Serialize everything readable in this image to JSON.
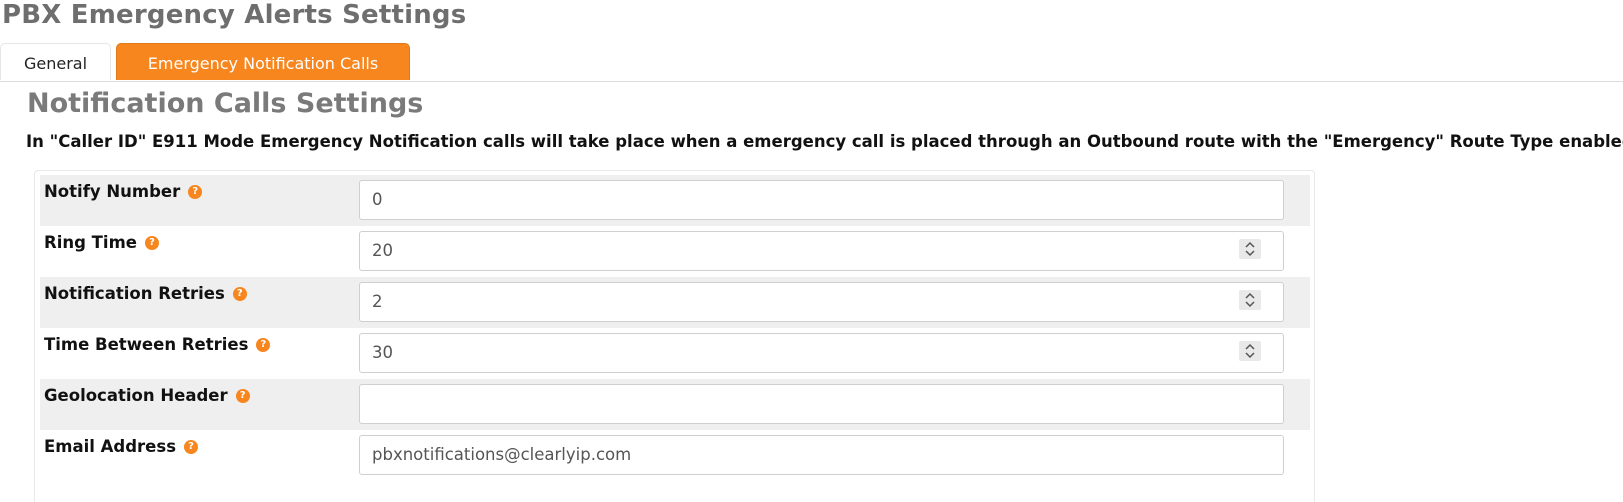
{
  "page": {
    "title": "PBX Emergency Alerts Settings"
  },
  "tabs": [
    {
      "label": "General",
      "active": false
    },
    {
      "label": "Emergency Notification Calls",
      "active": true
    }
  ],
  "section": {
    "title": "Notification Calls Settings",
    "description": "In \"Caller ID\" E911 Mode Emergency Notification calls will take place when a emergency call is placed through an Outbound route with the \"Emergency\" Route Type enabled."
  },
  "fields": [
    {
      "label": "Notify Number",
      "value": "0",
      "type": "text"
    },
    {
      "label": "Ring Time",
      "value": "20",
      "type": "number"
    },
    {
      "label": "Notification Retries",
      "value": "2",
      "type": "number"
    },
    {
      "label": "Time Between Retries",
      "value": "30",
      "type": "number"
    },
    {
      "label": "Geolocation Header",
      "value": "",
      "type": "text"
    },
    {
      "label": "Email Address",
      "value": "pbxnotifications@clearlyip.com",
      "type": "text"
    }
  ],
  "colors": {
    "accent": "#f7861e",
    "title": "#6e6e6e",
    "row_shade": "#efefef"
  },
  "icons": {
    "help": "question-circle-icon",
    "spinner": "up-down-spinner-icon"
  }
}
